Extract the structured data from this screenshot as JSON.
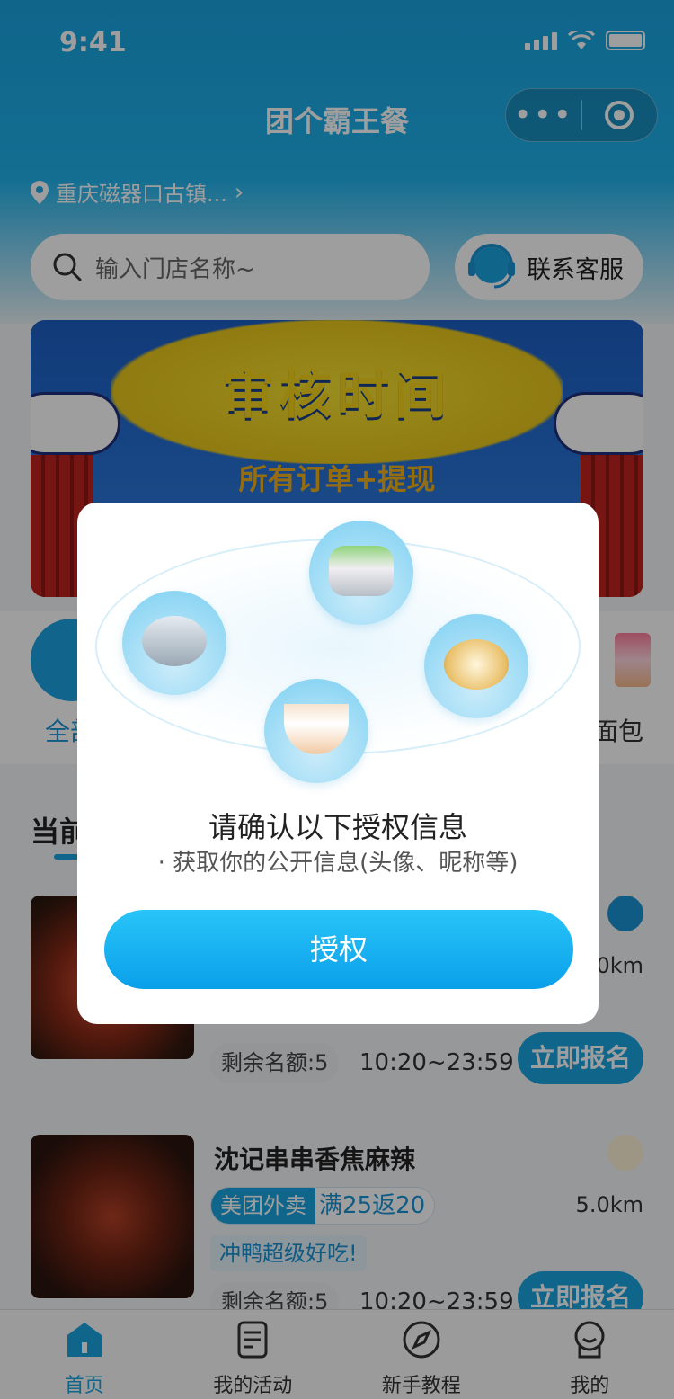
{
  "status_bar": {
    "time": "9:41"
  },
  "nav": {
    "title": "团个霸王餐",
    "more_glyph": "•••"
  },
  "location": {
    "text": "重庆磁器口古镇...",
    "chevron": "›"
  },
  "search": {
    "placeholder": "输入门店名称~"
  },
  "service_button": {
    "label": "联系客服"
  },
  "banner": {
    "headline": "审核时间",
    "subline": "所有订单+提现"
  },
  "categories": {
    "left_label": "全部",
    "right_label": "面包"
  },
  "section": {
    "title": "当前活动"
  },
  "stores": [
    {
      "name": "",
      "distance": "0km",
      "quota": "剩余名额:5",
      "hours": "10:20~23:59",
      "join_label": "立即报名",
      "platform_color": "#1a93d4"
    },
    {
      "name": "沈记串串香焦麻辣",
      "platform": "美团外卖",
      "reward": "满25返20",
      "slogan": "冲鸭超级好吃!",
      "distance": "5.0km",
      "quota": "剩余名额:5",
      "hours": "10:20~23:59",
      "join_label": "立即报名",
      "platform_color": "#f5c02a"
    }
  ],
  "tabbar": [
    {
      "label": "首页",
      "icon": "home-icon"
    },
    {
      "label": "我的活动",
      "icon": "document-icon"
    },
    {
      "label": "新手教程",
      "icon": "compass-icon"
    },
    {
      "label": "我的",
      "icon": "user-icon"
    }
  ],
  "modal": {
    "title": "请确认以下授权信息",
    "subtitle": "· 获取你的公开信息(头像、昵称等)",
    "button_label": "授权"
  },
  "colors": {
    "brand": "#1aa3e0",
    "button_top": "#29c4f8",
    "button_bottom": "#0aa0ea"
  }
}
